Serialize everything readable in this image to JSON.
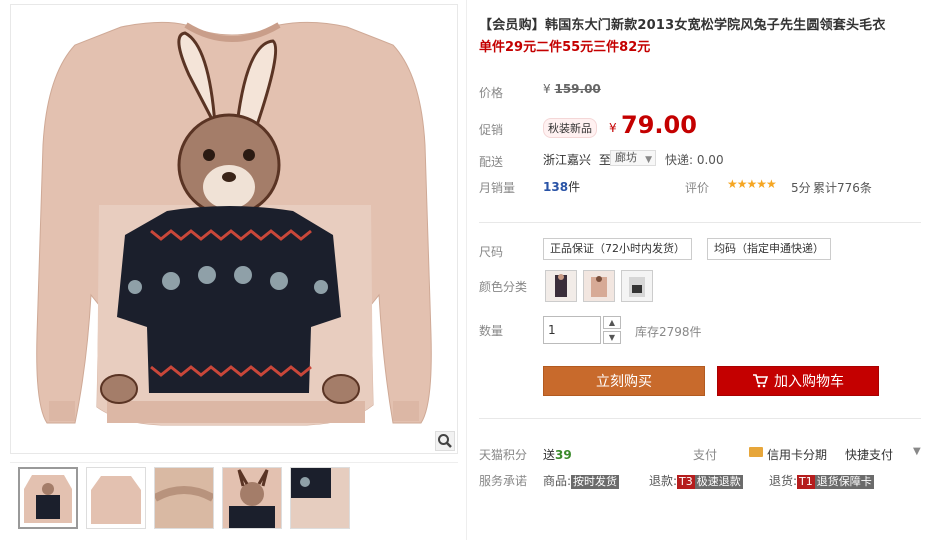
{
  "product": {
    "title": "【会员购】韩国东大门新款2013女宽松学院风兔子先生圆领套头毛衣",
    "subtitle": "单件29元二件55元三件82元"
  },
  "price": {
    "label": "价格",
    "currency": "¥",
    "original": "159.00",
    "promo_label": "促销",
    "promo_tag": "秋装新品",
    "current": "79.00"
  },
  "shipping": {
    "label": "配送",
    "from": "浙江嘉兴",
    "to_word": "至",
    "to": "廊坊",
    "fee": "快递: 0.00"
  },
  "sales": {
    "label": "月销量",
    "count": "138",
    "unit": "件",
    "rating_label": "评价",
    "stars": "★★★★★",
    "rating": "5分",
    "review_count": "累计776条"
  },
  "options": {
    "size_label": "尺码",
    "size_opt1": "正品保证（72小时内发货）",
    "size_opt2": "均码（指定申通快递）",
    "color_label": "颜色分类"
  },
  "quantity": {
    "label": "数量",
    "value": "1",
    "stock": "库存2798件"
  },
  "buttons": {
    "buy_now": "立刻购买",
    "add_cart": "加入购物车"
  },
  "points": {
    "label": "天猫积分",
    "prefix": "送",
    "value": "39"
  },
  "payment": {
    "label": "支付",
    "credit": "信用卡分期",
    "quick": "快捷支付"
  },
  "service": {
    "label": "服务承诺",
    "item1_prefix": "商品:",
    "item1_tag": "按时发货",
    "item2_prefix": "退款:",
    "item2_code": "T3",
    "item2_tag": "极速退款",
    "item3_prefix": "退货:",
    "item3_code": "T1",
    "item3_tag": "退货保障卡"
  },
  "colors": {
    "price_red": "#c40000",
    "buy_orange": "#c86a2c",
    "cart_red": "#c40000",
    "sweater_beige": "#e6c4b4"
  }
}
